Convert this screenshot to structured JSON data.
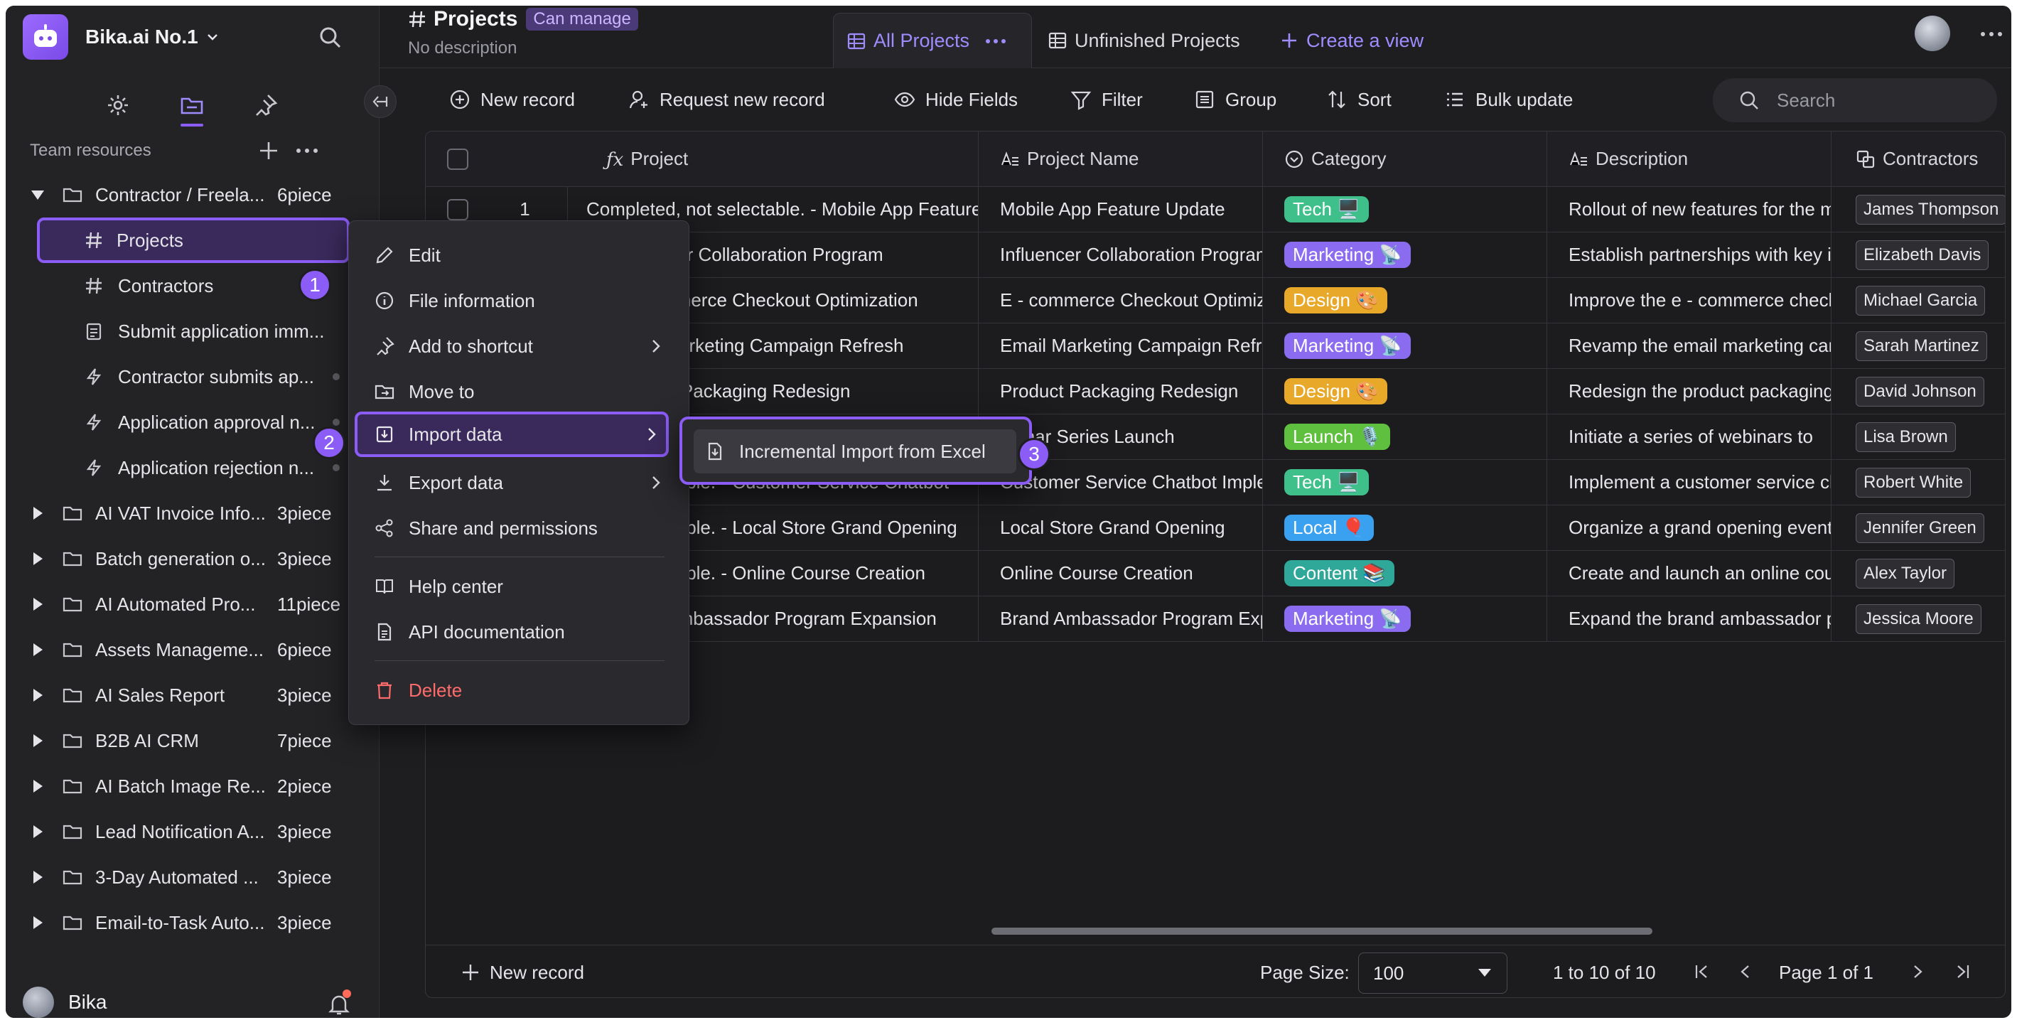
{
  "workspace": {
    "name": "Bika.ai No.1"
  },
  "sidebar": {
    "section_title": "Team resources",
    "tree": [
      {
        "label": "Contractor / Freela...",
        "count": "6piece",
        "expanded": true
      },
      {
        "label": "AI VAT Invoice Info...",
        "count": "3piece"
      },
      {
        "label": "Batch generation o...",
        "count": "3piece"
      },
      {
        "label": "AI Automated Pro...",
        "count": "11piece"
      },
      {
        "label": "Assets Manageme...",
        "count": "6piece"
      },
      {
        "label": "AI Sales Report",
        "count": "3piece"
      },
      {
        "label": "B2B AI CRM",
        "count": "7piece"
      },
      {
        "label": "AI Batch Image Re...",
        "count": "2piece"
      },
      {
        "label": "Lead Notification A...",
        "count": "3piece"
      },
      {
        "label": "3-Day Automated ...",
        "count": "3piece"
      },
      {
        "label": "Email-to-Task Auto...",
        "count": "3piece"
      }
    ],
    "children": [
      {
        "label": "Projects",
        "icon": "hash-icon"
      },
      {
        "label": "Contractors",
        "icon": "hash-icon"
      },
      {
        "label": "Submit application imm...",
        "icon": "form-icon"
      },
      {
        "label": "Contractor submits ap...",
        "icon": "bolt-icon"
      },
      {
        "label": "Application approval n...",
        "icon": "bolt-icon"
      },
      {
        "label": "Application rejection n...",
        "icon": "bolt-icon"
      }
    ],
    "user_name": "Bika"
  },
  "header": {
    "title": "Projects",
    "permission": "Can manage",
    "description": "No description",
    "views": [
      "All Projects",
      "Unfinished Projects"
    ],
    "create_view": "Create a view"
  },
  "toolbar": {
    "new_record": "New record",
    "request_new_record": "Request new record",
    "hide_fields": "Hide Fields",
    "filter": "Filter",
    "group": "Group",
    "sort": "Sort",
    "bulk_update": "Bulk update",
    "search_placeholder": "Search"
  },
  "grid": {
    "columns": [
      "Project",
      "Project Name",
      "Category",
      "Description",
      "Contractors"
    ],
    "rows": [
      {
        "num": "1",
        "project": "Completed, not selectable. - Mobile App Feature Update",
        "name": "Mobile App Feature Update",
        "category": "Tech 🖥️",
        "description": "Rollout of new features for the mobile app",
        "contractor": "James Thompson"
      },
      {
        "num": "",
        "project": "s - Influencer Collaboration Program",
        "name": "Influencer Collaboration Program",
        "category": "Marketing 📡",
        "description": "Establish partnerships with key influencers",
        "contractor": "Elizabeth Davis"
      },
      {
        "num": "",
        "project": "s - E - commerce Checkout Optimization",
        "name": "E - commerce Checkout Optimization",
        "category": "Design 🎨",
        "description": "Improve the e - commerce checkout",
        "contractor": "Michael Garcia"
      },
      {
        "num": "",
        "project": "s - Email Marketing Campaign Refresh",
        "name": "Email Marketing Campaign Refresh",
        "category": "Marketing 📡",
        "description": "Revamp the email marketing campaign",
        "contractor": "Sarah Martinez"
      },
      {
        "num": "",
        "project": "s - Product Packaging Redesign",
        "name": "Product Packaging Redesign",
        "category": "Design 🎨",
        "description": "Redesign the product packaging",
        "contractor": "David Johnson"
      },
      {
        "num": "",
        "project": "",
        "name": "ebinar Series Launch",
        "category": "Launch 🎙️",
        "description": "Initiate a series of webinars to",
        "contractor": "Lisa Brown"
      },
      {
        "num": "",
        "project": ", not selectable. - Customer Service Chatbot",
        "name": "Customer Service Chatbot Implementation",
        "category": "Tech 🖥️",
        "description": "Implement a customer service chatbot",
        "contractor": "Robert White"
      },
      {
        "num": "",
        "project": ", not selectable. - Local Store Grand Opening",
        "name": "Local Store Grand Opening",
        "category": "Local 🎈",
        "description": "Organize a grand opening event",
        "contractor": "Jennifer Green"
      },
      {
        "num": "",
        "project": ", not selectable. - Online Course Creation",
        "name": "Online Course Creation",
        "category": "Content 📚",
        "description": "Create and launch an online course",
        "contractor": "Alex Taylor"
      },
      {
        "num": "",
        "project": "s - Brand Ambassador Program Expansion",
        "name": "Brand Ambassador Program Expansion",
        "category": "Marketing 📡",
        "description": "Expand the brand ambassador program",
        "contractor": "Jessica Moore"
      }
    ],
    "footer": {
      "new_record": "New record",
      "page_size_label": "Page Size:",
      "page_size": "100",
      "range": "1 to 10 of 10",
      "page": "Page 1 of 1"
    }
  },
  "context_menu": {
    "items": [
      "Edit",
      "File information",
      "Add to shortcut",
      "Move to",
      "Import data",
      "Export data",
      "Share and permissions",
      "Help center",
      "API documentation",
      "Delete"
    ],
    "submenu": [
      "Incremental Import from Excel"
    ]
  },
  "steps": [
    "1",
    "2",
    "3"
  ],
  "colors": {
    "accent": "#8b5cf6",
    "tag_tech": "#3fbf8a",
    "tag_marketing": "#8b6cf0",
    "tag_design": "#e8a92a",
    "tag_launch": "#5fbf3f",
    "tag_local": "#3aa0f0",
    "tag_content": "#2fa89a"
  }
}
